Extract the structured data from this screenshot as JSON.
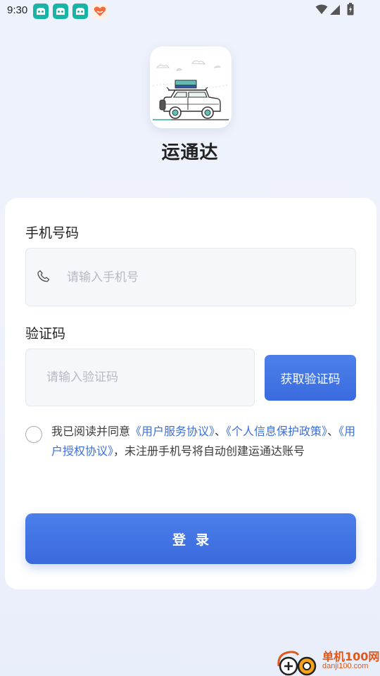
{
  "status_bar": {
    "time": "9:30",
    "notification_icons": [
      "app-notification-icon",
      "app-notification-icon",
      "app-notification-icon",
      "heart-app-icon"
    ],
    "system_icons": [
      "wifi-icon",
      "cellular-signal-icon",
      "battery-icon"
    ]
  },
  "header": {
    "app_name": "运通达"
  },
  "form": {
    "phone_label": "手机号码",
    "phone_placeholder": "请输入手机号",
    "phone_value": "",
    "code_label": "验证码",
    "code_placeholder": "请输入验证码",
    "code_value": "",
    "get_code_label": "获取验证码",
    "agreement": {
      "checked": false,
      "prefix": "我已阅读并同意",
      "user_service_link": "《用户服务协议》",
      "sep1": "、",
      "privacy_link": "《个人信息保护政策》",
      "sep2": "、",
      "authorization_link": "《用户授权协议》",
      "suffix": "，未注册手机号将自动创建运通达账号"
    },
    "login_label": "登录"
  },
  "watermark": {
    "title": "单机100网",
    "url": "danji100.com"
  },
  "colors": {
    "accent": "#3e6fd6",
    "button_top": "#4b7fea",
    "button_bottom": "#3a69dc",
    "notification_teal": "#1ab4a6",
    "watermark_orange": "#e2571a"
  }
}
